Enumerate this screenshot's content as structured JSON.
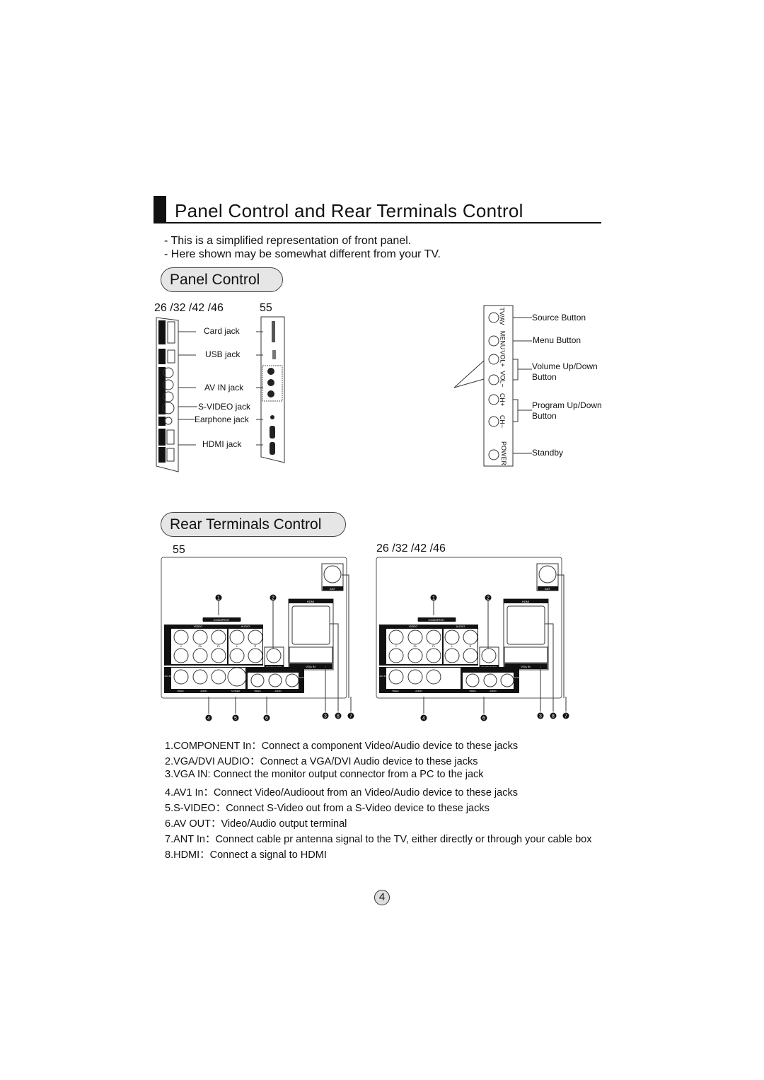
{
  "title": "Panel Control and Rear Terminals Control",
  "notes": [
    "- This is a simplified representation of front panel.",
    "- Here shown may be somewhat different from your TV."
  ],
  "panel_control": {
    "heading": "Panel Control",
    "model_small": "26 /32 /42 /46",
    "model_large": "55",
    "side_labels": [
      "Card jack",
      "USB jack",
      "AV IN jack",
      "S-VIDEO jack",
      "Earphone jack",
      "HDMI jack"
    ],
    "button_labels": [
      "TV/AV",
      "MENU",
      "VOL+",
      "VOL−",
      "CH+",
      "CH−",
      "POWER"
    ],
    "callouts": [
      "Source Button",
      "Menu Button",
      "Volume Up/Down",
      "Button",
      "Program Up/Down",
      "Button",
      "Standby"
    ]
  },
  "rear_control": {
    "heading": "Rear Terminals Control",
    "model_left": "55",
    "model_right": "26 /32 /42 /46",
    "diagram_labels": {
      "ant": "ANT",
      "hdmi": "HDMI",
      "component": "CONMPENT",
      "video": "VIDEO",
      "audio": "AUDIO",
      "vga_in": "VGA IN",
      "vga_dvi_audio": "VGA/DVI AUDIO",
      "av1_in": "AV1 IN",
      "av1_out": "AV1 OUT",
      "y": "Y",
      "pb": "Pb",
      "pr": "Pr",
      "l": "L",
      "r": "R",
      "svideo": "S-VIDEO",
      "audio_small": "AUDIO"
    },
    "markers_left": [
      "1",
      "2",
      "4",
      "5",
      "6",
      "3",
      "8",
      "7"
    ],
    "markers_right": [
      "1",
      "2",
      "4",
      "6",
      "3",
      "8",
      "7"
    ]
  },
  "descriptions": [
    "1.COMPONENT In：Connect a component Video/Audio device to these jacks",
    "2.VGA/DVI AUDIO：Connect a VGA/DVI Audio device to these jacks",
    "3.VGA IN: Connect the monitor output connector from a PC to the jack",
    "4.AV1 In：Connect Video/Audioout from an Video/Audio device to these jacks",
    "5.S-VIDEO：Connect S-Video out from a S-Video device to these jacks",
    "6.AV OUT：Video/Audio output terminal",
    "7.ANT In：Connect cable pr antenna signal to the TV, either directly or through your cable box",
    "8.HDMI：Connect a signal to HDMI"
  ],
  "page_number": "4"
}
